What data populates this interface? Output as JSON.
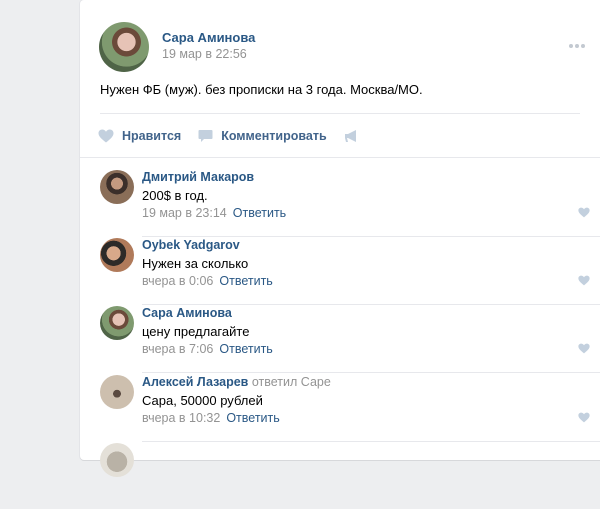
{
  "post": {
    "author": "Сара Аминова",
    "date": "19 мар в 22:56",
    "text": "Нужен ФБ (муж). без прописки на 3 года. Москва/МО.",
    "actions": {
      "like": "Нравится",
      "comment": "Комментировать"
    }
  },
  "comments": [
    {
      "author": "Дмитрий Макаров",
      "reply_to": "",
      "text": "200$ в год.",
      "time": "19 мар в 23:14",
      "reply_label": "Ответить"
    },
    {
      "author": "Oybek Yadgarov",
      "reply_to": "",
      "text": "Нужен за сколько",
      "time": "вчера в 0:06",
      "reply_label": "Ответить"
    },
    {
      "author": "Сара Аминова",
      "reply_to": "",
      "text": "цену предлагайте",
      "time": "вчера в 7:06",
      "reply_label": "Ответить"
    },
    {
      "author": "Алексей Лазарев",
      "reply_to": "ответил Саре",
      "text": "Сара, 50000 рублей",
      "time": "вчера в 10:32",
      "reply_label": "Ответить"
    }
  ],
  "colors": {
    "link": "#2a5885",
    "muted": "#939393",
    "action": "#42648b",
    "icon": "#c3c9d1",
    "background": "#edeef0"
  }
}
